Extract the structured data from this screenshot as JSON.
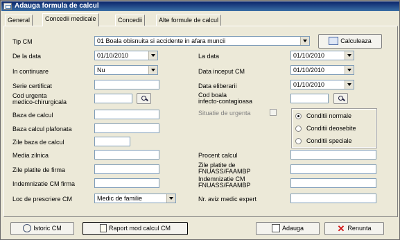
{
  "window": {
    "title": "Adauga formula de calcul"
  },
  "tabs": [
    {
      "label": "General"
    },
    {
      "label": "Concedii medicale"
    },
    {
      "label": "Concedii"
    },
    {
      "label": "Alte formule de calcul"
    }
  ],
  "form": {
    "tip_cm": {
      "label": "Tip CM",
      "value": "01 Boala obisnuita si accidente in afara muncii"
    },
    "calculeaza": {
      "label": "Calculeaza"
    },
    "de_la_data": {
      "label": "De la data",
      "value": "01/10/2010"
    },
    "la_data": {
      "label": "La data",
      "value": "01/10/2010"
    },
    "in_continuare": {
      "label": "In continuare",
      "value": "Nu"
    },
    "data_inceput_cm": {
      "label": "Data inceput CM",
      "value": "01/10/2010"
    },
    "serie_certificat": {
      "label": "Serie certificat",
      "value": ""
    },
    "data_eliberarii": {
      "label": "Data eliberarii",
      "value": "01/10/2010"
    },
    "cod_urgenta": {
      "label_line1": "Cod urgenta",
      "label_line2": "medico-chirurgicala",
      "value": ""
    },
    "cod_boala": {
      "label_line1": "Cod boala",
      "label_line2": "infecto-contagioasa",
      "value": ""
    },
    "baza_de_calcul": {
      "label": "Baza de calcul",
      "value": ""
    },
    "situatie_urgenta": {
      "label": "Situatie de urgenta"
    },
    "baza_calcul_plafonata": {
      "label": "Baza calcul plafonata",
      "value": ""
    },
    "zile_baza_de_calcul": {
      "label": "Zile baza de calcul",
      "value": ""
    },
    "media_zilnica": {
      "label": "Media zilnica",
      "value": ""
    },
    "procent_calcul": {
      "label": "Procent calcul",
      "value": ""
    },
    "zile_platite_firma": {
      "label": "Zile platite de firma",
      "value": ""
    },
    "zile_platite_fnuass": {
      "label_line1": "Zile platite de",
      "label_line2": "FNUASS/FAAMBP",
      "value": ""
    },
    "indemnizatie_cm_firma": {
      "label": "Indemnizatie CM firma",
      "value": ""
    },
    "indemnizatie_cm_fnuass": {
      "label_line1": "Indemnizatie CM",
      "label_line2": "FNUASS/FAAMBP",
      "value": ""
    },
    "loc_de_prescriere": {
      "label": "Loc de prescriere CM",
      "value": "Medic de familie"
    },
    "nr_aviz_medic_expert": {
      "label": "Nr. aviz medic expert",
      "value": ""
    },
    "conditii": [
      {
        "label": "Conditii normale",
        "selected": true
      },
      {
        "label": "Conditii deosebite",
        "selected": false
      },
      {
        "label": "Conditii speciale",
        "selected": false
      }
    ]
  },
  "buttons": {
    "istoric": "Istoric CM",
    "raport": "Raport mod calcul CM",
    "adauga": "Adauga",
    "renunta": "Renunta"
  },
  "icons": [
    "window-icon",
    "calculator-icon",
    "search-icon",
    "history-icon",
    "report-icon",
    "add-icon",
    "cancel-icon"
  ],
  "colors": {
    "title_bar": "#0a246a",
    "background": "#ece9d8",
    "cancel_x": "#d01010"
  }
}
